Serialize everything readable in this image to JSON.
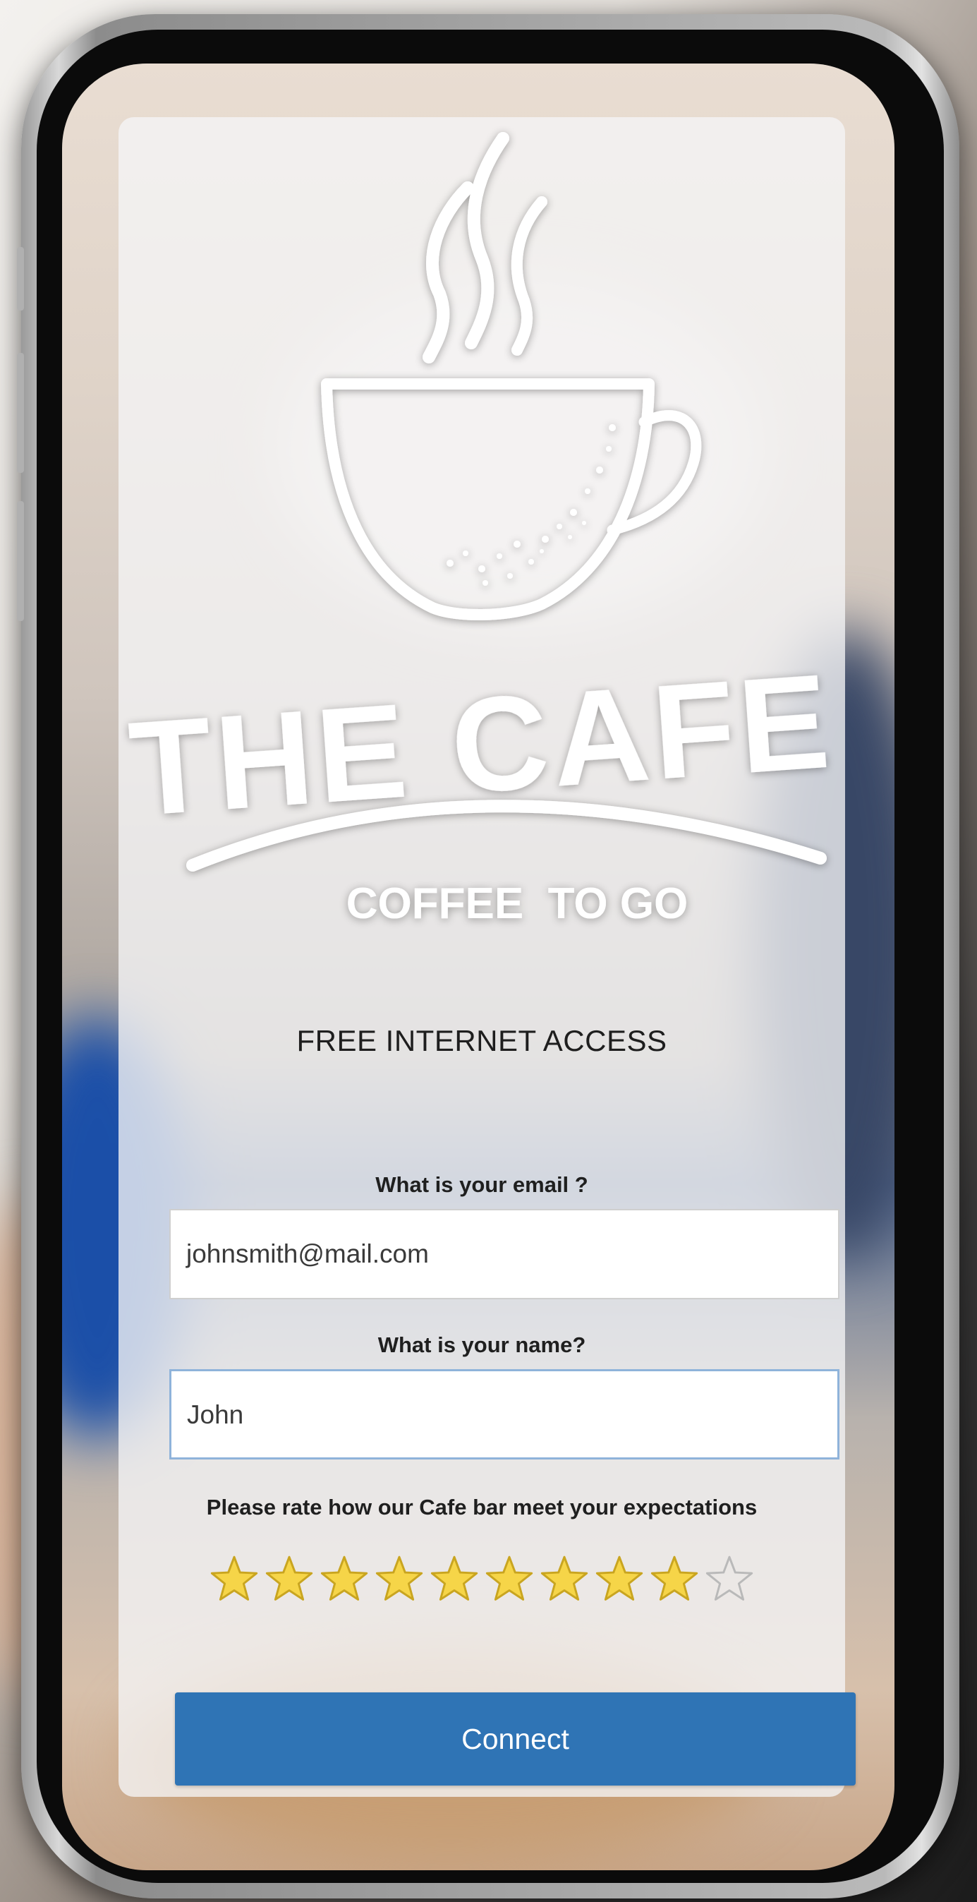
{
  "brand": {
    "title": "THE CAFE",
    "tagline": "COFFEE  TO GO"
  },
  "heading": "FREE INTERNET ACCESS",
  "form": {
    "email_label": "What is your email ?",
    "email_value": "johnsmith@mail.com",
    "name_label": "What is your name?",
    "name_value": "John",
    "rating_label": "Please rate how our Cafe bar meet your expectations",
    "rating": 9,
    "rating_max": 10,
    "connect_label": "Connect"
  },
  "colors": {
    "accent": "#2f74b5",
    "star_fill": "#f6d548",
    "star_stroke": "#c9a520"
  }
}
